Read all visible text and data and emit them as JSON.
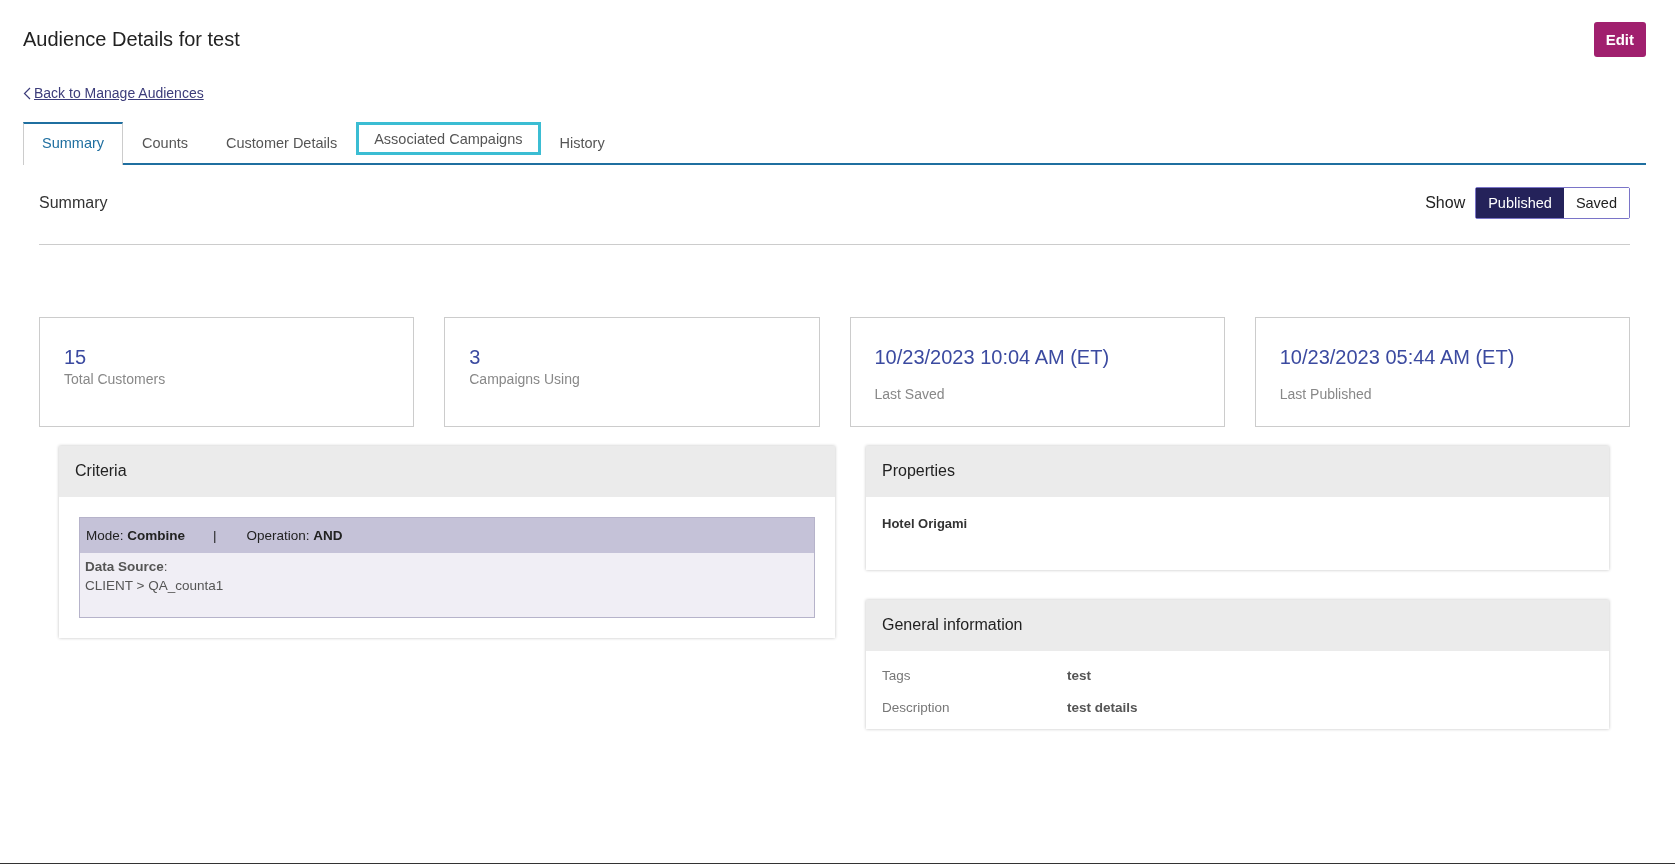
{
  "page": {
    "title": "Audience Details for test",
    "edit_button": "Edit",
    "back_link": "Back to Manage Audiences"
  },
  "tabs": [
    {
      "label": "Summary",
      "selected": true,
      "focused": false
    },
    {
      "label": "Counts",
      "selected": false,
      "focused": false
    },
    {
      "label": "Customer Details",
      "selected": false,
      "focused": false
    },
    {
      "label": "Associated Campaigns",
      "selected": false,
      "focused": true
    },
    {
      "label": "History",
      "selected": false,
      "focused": false
    }
  ],
  "summary": {
    "heading": "Summary",
    "show_label": "Show",
    "options": [
      {
        "label": "Published",
        "selected": true
      },
      {
        "label": "Saved",
        "selected": false
      }
    ]
  },
  "stats": [
    {
      "kind": "count",
      "value": "15",
      "label": "Total Customers"
    },
    {
      "kind": "count",
      "value": "3",
      "label": "Campaigns Using"
    },
    {
      "kind": "timestamp",
      "value": "10/23/2023 10:04 AM (ET)",
      "label": "Last Saved"
    },
    {
      "kind": "timestamp",
      "value": "10/23/2023 05:44 AM (ET)",
      "label": "Last Published"
    }
  ],
  "criteria": {
    "title": "Criteria",
    "mode": "Mode: **Combine**",
    "separator": "|",
    "operation": "Operation: **AND**",
    "source_label": "**Data Source**:",
    "source_value": "CLIENT > QA_counta1"
  },
  "properties": {
    "title": "Properties",
    "items": [
      "Hotel Origami"
    ]
  },
  "general_information": {
    "title": "General information",
    "rows": [
      {
        "label": "Tags",
        "value": "test"
      },
      {
        "label": "Description",
        "value": "test details"
      }
    ]
  }
}
